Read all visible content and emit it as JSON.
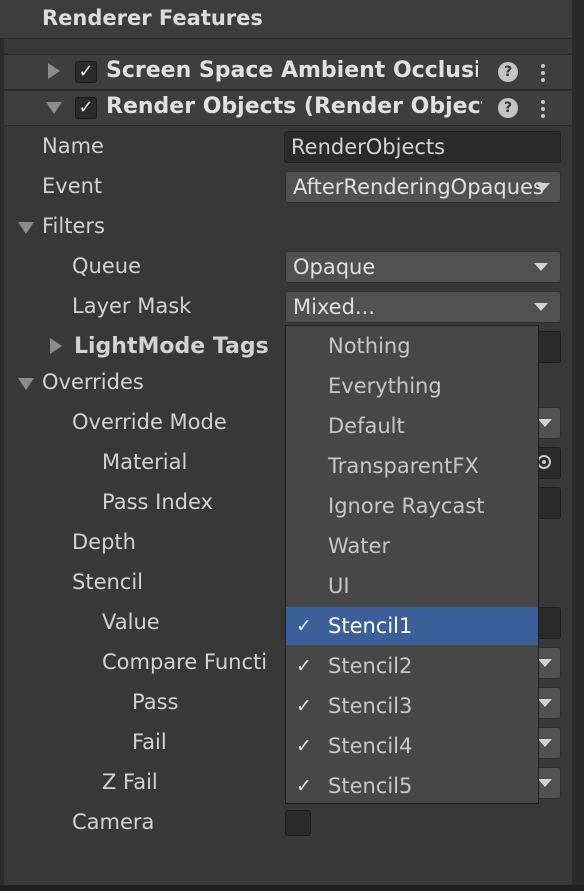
{
  "header": {
    "title": "Renderer Features"
  },
  "features": [
    {
      "title": "Screen Space Ambient Occlusio",
      "expanded": false,
      "enabled": true
    },
    {
      "title": "Render Objects (Render Objects",
      "expanded": true,
      "enabled": true
    }
  ],
  "help_glyph": "?",
  "check_glyph": "✓",
  "properties": {
    "name_label": "Name",
    "name_value": "RenderObjects",
    "event_label": "Event",
    "event_value": "AfterRenderingOpaques",
    "filters_label": "Filters",
    "queue_label": "Queue",
    "queue_value": "Opaque",
    "layer_mask_label": "Layer Mask",
    "layer_mask_value": "Mixed...",
    "lightmode_label": "LightMode Tags",
    "overrides_label": "Overrides",
    "override_mode_label": "Override Mode",
    "material_label": "Material",
    "pass_index_label": "Pass Index",
    "depth_label": "Depth",
    "stencil_label": "Stencil",
    "value_label": "Value",
    "compare_label": "Compare Functi",
    "pass_label": "Pass",
    "fail_label": "Fail",
    "zfail_label": "Z Fail",
    "camera_label": "Camera"
  },
  "layer_menu": {
    "items": [
      {
        "label": "Nothing",
        "checked": false,
        "selected": false
      },
      {
        "label": "Everything",
        "checked": false,
        "selected": false
      },
      {
        "label": "Default",
        "checked": false,
        "selected": false
      },
      {
        "label": "TransparentFX",
        "checked": false,
        "selected": false
      },
      {
        "label": "Ignore Raycast",
        "checked": false,
        "selected": false
      },
      {
        "label": "Water",
        "checked": false,
        "selected": false
      },
      {
        "label": "UI",
        "checked": false,
        "selected": false
      },
      {
        "label": "Stencil1",
        "checked": true,
        "selected": true
      },
      {
        "label": "Stencil2",
        "checked": true,
        "selected": false
      },
      {
        "label": "Stencil3",
        "checked": true,
        "selected": false
      },
      {
        "label": "Stencil4",
        "checked": true,
        "selected": false
      },
      {
        "label": "Stencil5",
        "checked": true,
        "selected": false
      }
    ],
    "check_mark": "✓",
    "selected_color": "#3a5f99"
  }
}
